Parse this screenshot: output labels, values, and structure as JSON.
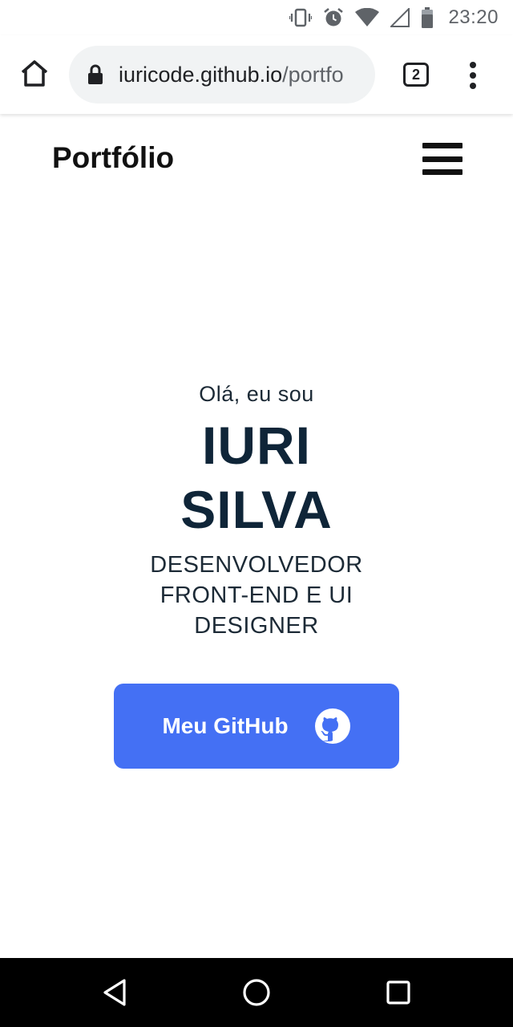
{
  "status_bar": {
    "time": "23:20",
    "icons": [
      "vibrate-icon",
      "alarm-icon",
      "wifi-icon",
      "signal-icon",
      "battery-icon"
    ]
  },
  "browser": {
    "url_host": "iuricode.github.io",
    "url_path": "/portfo",
    "tab_count": "2",
    "icons": [
      "home-icon",
      "lock-icon",
      "tabs-icon",
      "more-vert-icon"
    ]
  },
  "header": {
    "title": "Portfólio",
    "menu_icon": "hamburger-icon"
  },
  "hero": {
    "greeting": "Olá, eu sou",
    "name_first": "IURI",
    "name_last": "SILVA",
    "role": "DESENVOLVEDOR FRONT-END E UI DESIGNER"
  },
  "cta": {
    "label": "Meu GitHub",
    "icon": "github-icon"
  },
  "nav_bar": {
    "icons": [
      "back-icon",
      "home-circle-icon",
      "recents-icon"
    ]
  },
  "colors": {
    "accent": "#4470f4",
    "heading": "#0f2538",
    "nav_bar": "#000000"
  }
}
